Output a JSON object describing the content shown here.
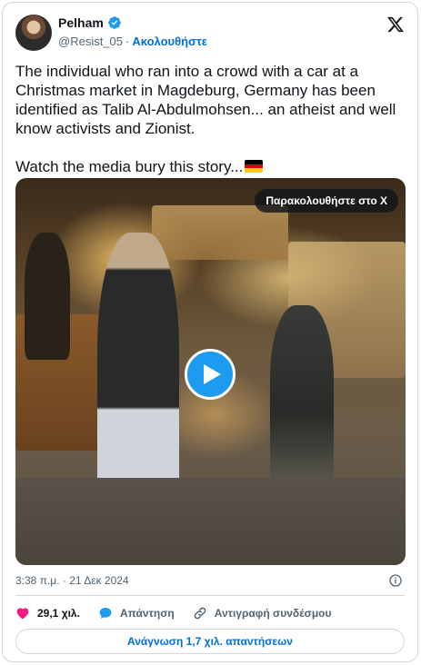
{
  "author": {
    "name": "Pelham",
    "handle": "@Resist_05",
    "separator": "·",
    "follow_label": "Ακολουθήστε"
  },
  "tweet": {
    "line1": "The individual who ran into a crowd with a car at a Christmas market in Magdeburg, Germany has been identified as Talib Al-Abdulmohsen... an atheist and well know activists and Zionist.",
    "line2": "Watch the media bury this story...",
    "emoji": "germany-flag"
  },
  "media": {
    "watch_label": "Παρακολουθήστε στο X",
    "play_icon": "play-icon"
  },
  "meta": {
    "timestamp": "3:38 π.μ. · 21 Δεκ 2024"
  },
  "actions": {
    "likes": "29,1 χιλ.",
    "reply_label": "Απάντηση",
    "copy_link_label": "Αντιγραφή συνδέσμου"
  },
  "replies_button": "Ανάγνωση 1,7 χιλ. απαντήσεων",
  "colors": {
    "accent": "#1d9bf0",
    "link": "#006fd6",
    "like": "#f91880",
    "muted": "#536471",
    "border": "#cfd9de"
  }
}
